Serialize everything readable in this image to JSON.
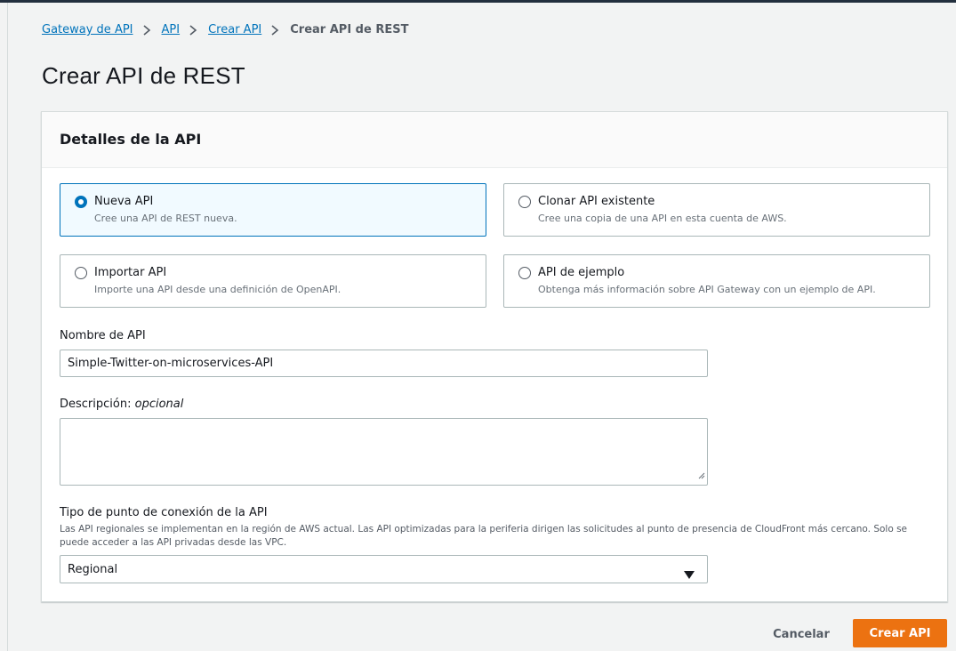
{
  "breadcrumb": {
    "items": [
      "Gateway de API",
      "API",
      "Crear API"
    ],
    "current": "Crear API de REST"
  },
  "page": {
    "title": "Crear API de REST"
  },
  "panel": {
    "title": "Detalles de la API",
    "options": [
      {
        "label": "Nueva API",
        "description": "Cree una API de REST nueva.",
        "selected": true
      },
      {
        "label": "Clonar API existente",
        "description": "Cree una copia de una API en esta cuenta de AWS.",
        "selected": false
      },
      {
        "label": "Importar API",
        "description": "Importe una API desde una definición de OpenAPI.",
        "selected": false
      },
      {
        "label": "API de ejemplo",
        "description": "Obtenga más información sobre API Gateway con un ejemplo de API.",
        "selected": false
      }
    ],
    "name_field": {
      "label": "Nombre de API",
      "value": "Simple-Twitter-on-microservices-API"
    },
    "description_field": {
      "label": "Descripción",
      "optional": "opcional",
      "value": ""
    },
    "endpoint_field": {
      "label": "Tipo de punto de conexión de la API",
      "hint": "Las API regionales se implementan en la región de AWS actual. Las API optimizadas para la periferia dirigen las solicitudes al punto de presencia de CloudFront más cercano. Solo se puede acceder a las API privadas desde las VPC.",
      "value": "Regional"
    }
  },
  "actions": {
    "cancel_label": "Cancelar",
    "create_label": "Crear API"
  },
  "colors": {
    "primary_button": "#ec7211",
    "link": "#0073bb",
    "selected_tile_border": "#0073bb"
  }
}
